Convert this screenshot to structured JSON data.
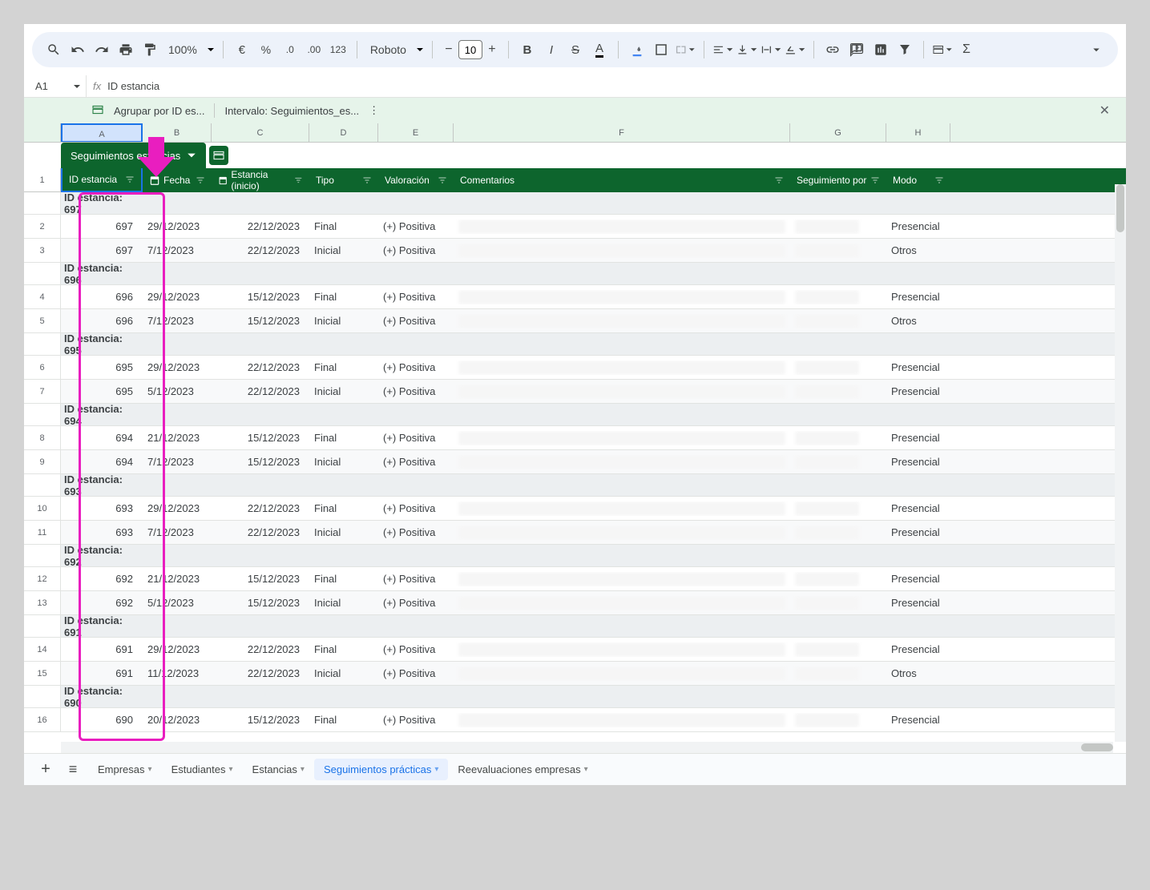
{
  "toolbar": {
    "zoom": "100%",
    "font": "Roboto",
    "fontSize": "10"
  },
  "formulaBar": {
    "cellRef": "A1",
    "value": "ID estancia"
  },
  "groupBar": {
    "groupBy": "Agrupar por ID es...",
    "interval": "Intervalo:  Seguimientos_es..."
  },
  "greenTab": "Seguimientos estancias",
  "colHeaders": [
    "A",
    "B",
    "C",
    "D",
    "E",
    "F",
    "G",
    "H"
  ],
  "headers": {
    "idEstancia": "ID estancia",
    "fecha": "Fecha",
    "estanciaInicio": "Estancia (inicio)",
    "tipo": "Tipo",
    "valoracion": "Valoración",
    "comentarios": "Comentarios",
    "seguimientoPor": "Seguimiento por",
    "modo": "Modo"
  },
  "groupPrefix": "ID estancia: ",
  "groups": [
    {
      "id": "697",
      "rows": [
        {
          "num": "2",
          "id": "697",
          "fecha": "29/12/2023",
          "inicio": "22/12/2023",
          "tipo": "Final",
          "val": "(+) Positiva",
          "modo": "Presencial"
        },
        {
          "num": "3",
          "id": "697",
          "fecha": "7/12/2023",
          "inicio": "22/12/2023",
          "tipo": "Inicial",
          "val": "(+) Positiva",
          "modo": "Otros"
        }
      ]
    },
    {
      "id": "696",
      "rows": [
        {
          "num": "4",
          "id": "696",
          "fecha": "29/12/2023",
          "inicio": "15/12/2023",
          "tipo": "Final",
          "val": "(+) Positiva",
          "modo": "Presencial"
        },
        {
          "num": "5",
          "id": "696",
          "fecha": "7/12/2023",
          "inicio": "15/12/2023",
          "tipo": "Inicial",
          "val": "(+) Positiva",
          "modo": "Otros"
        }
      ]
    },
    {
      "id": "695",
      "rows": [
        {
          "num": "6",
          "id": "695",
          "fecha": "29/12/2023",
          "inicio": "22/12/2023",
          "tipo": "Final",
          "val": "(+) Positiva",
          "modo": "Presencial"
        },
        {
          "num": "7",
          "id": "695",
          "fecha": "5/12/2023",
          "inicio": "22/12/2023",
          "tipo": "Inicial",
          "val": "(+) Positiva",
          "modo": "Presencial"
        }
      ]
    },
    {
      "id": "694",
      "rows": [
        {
          "num": "8",
          "id": "694",
          "fecha": "21/12/2023",
          "inicio": "15/12/2023",
          "tipo": "Final",
          "val": "(+) Positiva",
          "modo": "Presencial"
        },
        {
          "num": "9",
          "id": "694",
          "fecha": "7/12/2023",
          "inicio": "15/12/2023",
          "tipo": "Inicial",
          "val": "(+) Positiva",
          "modo": "Presencial"
        }
      ]
    },
    {
      "id": "693",
      "rows": [
        {
          "num": "10",
          "id": "693",
          "fecha": "29/12/2023",
          "inicio": "22/12/2023",
          "tipo": "Final",
          "val": "(+) Positiva",
          "modo": "Presencial"
        },
        {
          "num": "11",
          "id": "693",
          "fecha": "7/12/2023",
          "inicio": "22/12/2023",
          "tipo": "Inicial",
          "val": "(+) Positiva",
          "modo": "Presencial"
        }
      ]
    },
    {
      "id": "692",
      "rows": [
        {
          "num": "12",
          "id": "692",
          "fecha": "21/12/2023",
          "inicio": "15/12/2023",
          "tipo": "Final",
          "val": "(+) Positiva",
          "modo": "Presencial"
        },
        {
          "num": "13",
          "id": "692",
          "fecha": "5/12/2023",
          "inicio": "15/12/2023",
          "tipo": "Inicial",
          "val": "(+) Positiva",
          "modo": "Presencial"
        }
      ]
    },
    {
      "id": "691",
      "rows": [
        {
          "num": "14",
          "id": "691",
          "fecha": "29/12/2023",
          "inicio": "22/12/2023",
          "tipo": "Final",
          "val": "(+) Positiva",
          "modo": "Presencial"
        },
        {
          "num": "15",
          "id": "691",
          "fecha": "11/12/2023",
          "inicio": "22/12/2023",
          "tipo": "Inicial",
          "val": "(+) Positiva",
          "modo": "Otros"
        }
      ]
    },
    {
      "id": "690",
      "rows": [
        {
          "num": "16",
          "id": "690",
          "fecha": "20/12/2023",
          "inicio": "15/12/2023",
          "tipo": "Final",
          "val": "(+) Positiva",
          "modo": "Presencial"
        }
      ]
    }
  ],
  "sheetTabs": [
    {
      "label": "Empresas",
      "active": false
    },
    {
      "label": "Estudiantes",
      "active": false
    },
    {
      "label": "Estancias",
      "active": false
    },
    {
      "label": "Seguimientos prácticas",
      "active": true
    },
    {
      "label": "Reevaluaciones empresas",
      "active": false
    }
  ],
  "rowOneLabel": "1"
}
